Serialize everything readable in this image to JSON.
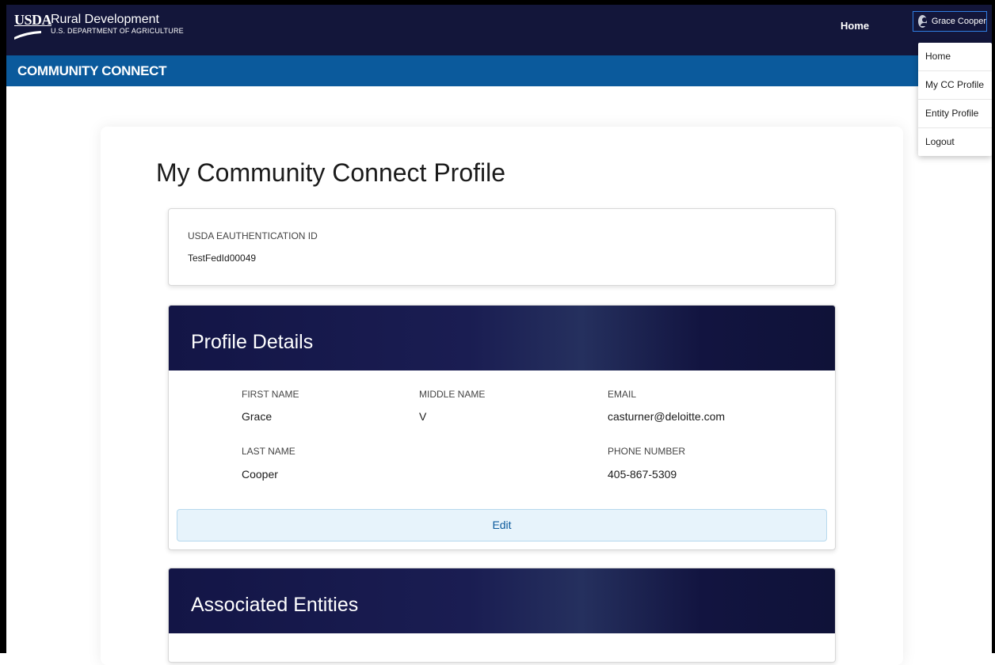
{
  "header": {
    "logo_mark": "USDA",
    "logo_title": "Rural Development",
    "logo_subtitle": "U.S. DEPARTMENT OF AGRICULTURE",
    "nav_home": "Home",
    "user_name": "Grace Cooper"
  },
  "app_bar": {
    "title": "COMMUNITY CONNECT"
  },
  "user_menu": {
    "items": [
      {
        "label": "Home"
      },
      {
        "label": "My CC Profile"
      },
      {
        "label": "Entity Profile"
      },
      {
        "label": "Logout"
      }
    ]
  },
  "page": {
    "title": "My Community Connect Profile"
  },
  "eauth": {
    "label": "USDA EAUTHENTICATION ID",
    "value": "TestFedId00049"
  },
  "profile": {
    "title": "Profile Details",
    "fields": {
      "first_name": {
        "label": "FIRST NAME",
        "value": "Grace"
      },
      "middle_name": {
        "label": "MIDDLE NAME",
        "value": "V"
      },
      "email": {
        "label": "EMAIL",
        "value": "casturner@deloitte.com"
      },
      "last_name": {
        "label": "LAST NAME",
        "value": "Cooper"
      },
      "phone": {
        "label": "PHONE NUMBER",
        "value": "405-867-5309"
      }
    },
    "edit_label": "Edit"
  },
  "entities": {
    "title": "Associated Entities"
  }
}
